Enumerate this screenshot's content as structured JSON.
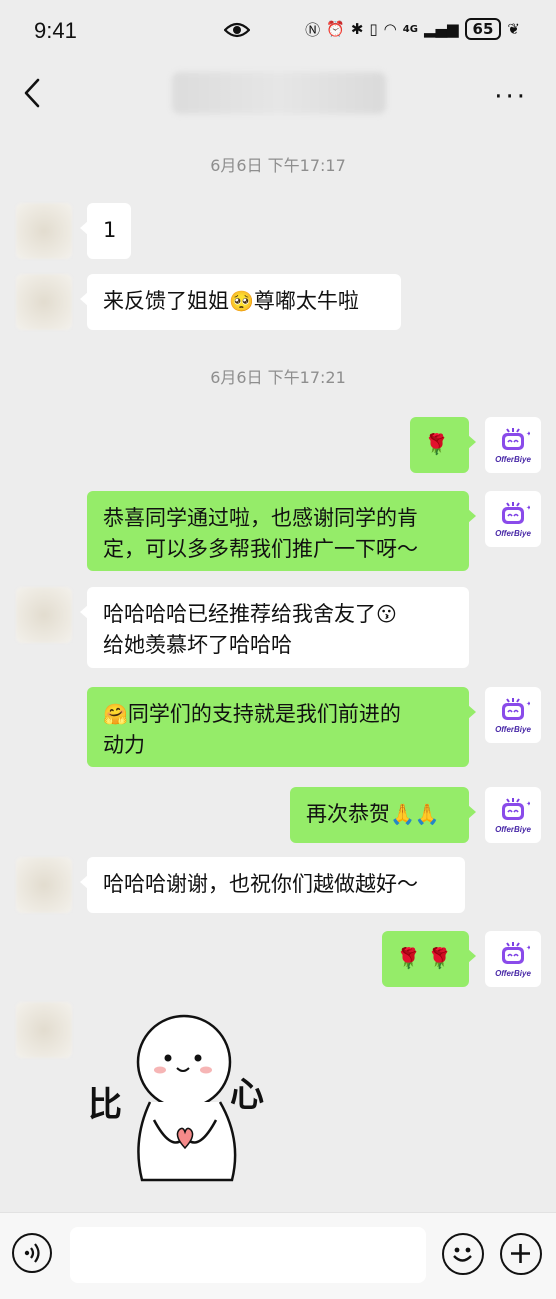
{
  "status": {
    "time": "9:41",
    "signal": "4G",
    "battery": "65"
  },
  "header": {
    "title": ""
  },
  "brand": {
    "avatar_name": "OfferBiye"
  },
  "messages": {
    "ts1": "6月6日 下午17:17",
    "m1": "1",
    "m2_text": "来反馈了姐姐",
    "m2_emoji": "🥺",
    "m2_text2": "尊嘟太牛啦",
    "ts2": "6月6日 下午17:21",
    "m3_emoji": "🌹",
    "m4_line1": "恭喜同学通过啦，也感谢同学的肯",
    "m4_line2": "定，可以多多帮我们推广一下呀～",
    "m5_line1_text": "哈哈哈哈已经推荐给我舍友了",
    "m5_line1_emoji": "😗",
    "m5_line2": "给她羡慕坏了哈哈哈",
    "m6_emoji": "🤗",
    "m6_line1": "同学们的支持就是我们前进的",
    "m6_line2": "动力",
    "m7_text": "再次恭贺",
    "m7_emoji": "🙏🙏",
    "m8": "哈哈哈谢谢，也祝你们越做越好～",
    "m9_emoji": "🌹 🌹",
    "sticker_text_left": "比",
    "sticker_text_right": "心"
  },
  "colors": {
    "self_bubble": "#95ec69",
    "other_bubble": "#ffffff",
    "background": "#ededed",
    "brand": "#7b3fe4"
  }
}
